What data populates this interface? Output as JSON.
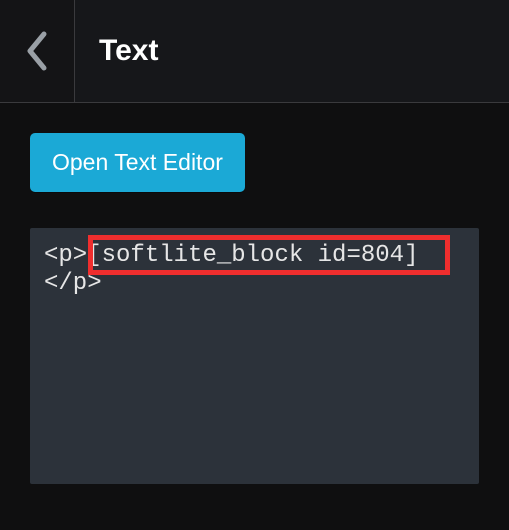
{
  "header": {
    "title": "Text"
  },
  "actions": {
    "open_editor_label": "Open Text Editor"
  },
  "code": {
    "tag_open": "<p>",
    "shortcode": "[softlite_block id=804]",
    "tag_close": "</p>"
  }
}
